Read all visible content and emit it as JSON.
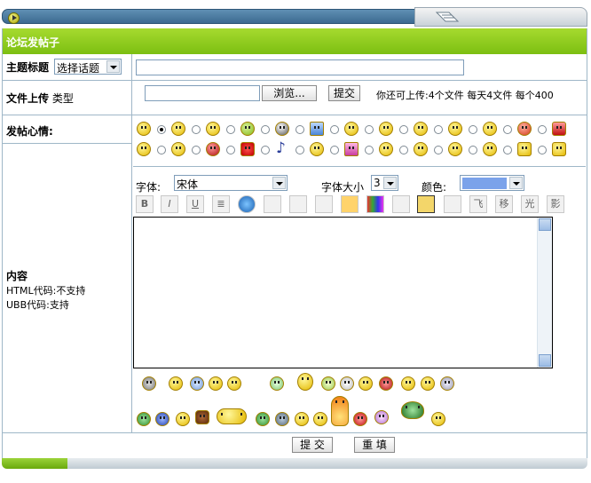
{
  "header": {
    "title": "论坛发帖子"
  },
  "subject": {
    "label": "主题标题",
    "topic_select": "选择话题"
  },
  "upload": {
    "label": "文件上传",
    "type_label": "类型",
    "browse_label": "浏览...",
    "submit_label": "提交",
    "quota_text": "你还可上传:4个文件  每天4文件  每个400"
  },
  "mood": {
    "label": "发帖心情:"
  },
  "editor": {
    "font_label": "字体:",
    "font_value": "宋体",
    "size_label": "字体大小",
    "size_value": "3",
    "color_label": "颜色:",
    "color_value": "#7ba2ea",
    "toolbar": [
      "B",
      "I",
      "U",
      "≣",
      "globe",
      "mail",
      "flash",
      "media",
      "down",
      "wave",
      "eye",
      "img",
      "quote",
      "飞",
      "移",
      "光",
      "影"
    ]
  },
  "content": {
    "label": "内容",
    "html_note": "HTML代码:不支持",
    "ubb_note": "UBB代码:支持"
  },
  "footer": {
    "submit_label": "提 交",
    "reset_label": "重 填"
  },
  "colors": {
    "accent_green": "#86c51a",
    "border": "#9fb7c8",
    "title_blue": "#3c6a90"
  }
}
